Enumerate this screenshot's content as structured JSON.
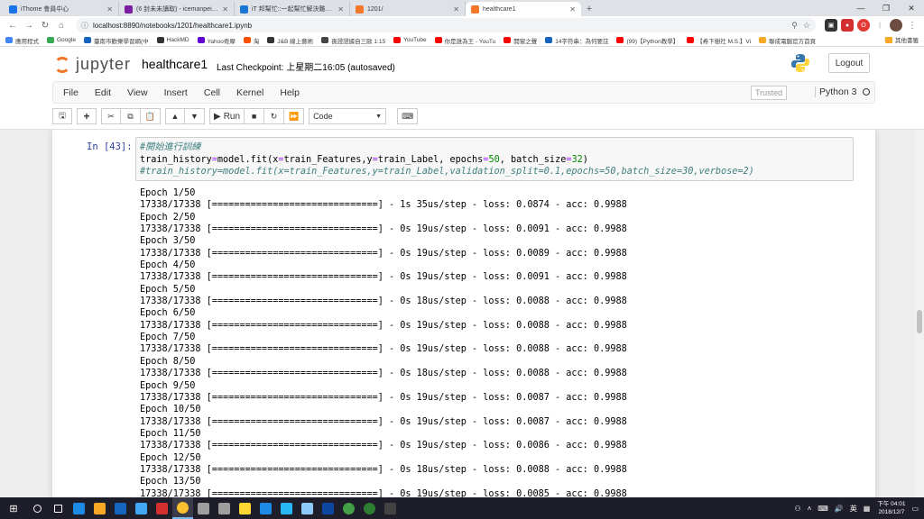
{
  "browser": {
    "tabs": [
      {
        "title": "iThome 會員中心",
        "color": "#1a73e8",
        "active": false
      },
      {
        "title": "(6 封未未讀取) - icemanpei@yahoo",
        "color": "#7b1fa2",
        "active": false
      },
      {
        "title": "iT 邦幫忙::一起幫忙解決難題，拯",
        "color": "#1976d2",
        "active": false
      },
      {
        "title": "1201/",
        "color": "#f37726",
        "active": false
      },
      {
        "title": "healthcare1",
        "color": "#f37726",
        "active": true
      }
    ],
    "url": "localhost:8890/notebooks/1201/healthcare1.ipynb",
    "bookmarks": [
      {
        "label": "應用程式",
        "color": "#4285f4"
      },
      {
        "label": "Google",
        "color": "#34a853"
      },
      {
        "label": "臺南市歡樂學習網(中",
        "color": "#1565c0"
      },
      {
        "label": "HackMD",
        "color": "#333333"
      },
      {
        "label": "Yahoo奇摩",
        "color": "#6001d2"
      },
      {
        "label": "淘",
        "color": "#ff5000"
      },
      {
        "label": "J&B 線上藝術",
        "color": "#333333"
      },
      {
        "label": "喪證證據自三歐 1:15",
        "color": "#444444"
      },
      {
        "label": "YouTube",
        "color": "#ff0000"
      },
      {
        "label": "你是誰為王 - YouTu",
        "color": "#ff0000"
      },
      {
        "label": "開窗之聲",
        "color": "#ff0000"
      },
      {
        "label": "14字符串：為何要註",
        "color": "#1565c0"
      },
      {
        "label": "(99)【Python教學】",
        "color": "#ff0000"
      },
      {
        "label": "【希下樹社 M.S.】Vi",
        "color": "#ff0000"
      },
      {
        "label": "聯成電腦官方首頁",
        "color": "#f9a825"
      }
    ],
    "bookmarks_more": "»",
    "bookmarks_other": "其他書籤"
  },
  "jupyter": {
    "logo_text": "jupyter",
    "notebook_name": "healthcare1",
    "checkpoint": "Last Checkpoint: 上星期二16:05   (autosaved)",
    "logout_label": "Logout",
    "menu": [
      "File",
      "Edit",
      "View",
      "Insert",
      "Cell",
      "Kernel",
      "Help"
    ],
    "trusted_label": "Trusted",
    "kernel_name": "Python 3",
    "toolbar": {
      "run_label": "Run",
      "cell_type": "Code"
    }
  },
  "cell": {
    "prompt": "In [43]:",
    "code_lines": [
      "#開始進行訓練",
      "train_history=model.fit(x=train_Features,y=train_Label, epochs=50, batch_size=32)",
      "#train_history=model.fit(x=train_Features,y=train_Label,validation_split=0.1,epochs=50,batch_size=30,verbose=2)"
    ],
    "output_lines": [
      "Epoch 1/50",
      "17338/17338 [==============================] - 1s 35us/step - loss: 0.0874 - acc: 0.9988",
      "Epoch 2/50",
      "17338/17338 [==============================] - 0s 19us/step - loss: 0.0091 - acc: 0.9988",
      "Epoch 3/50",
      "17338/17338 [==============================] - 0s 19us/step - loss: 0.0089 - acc: 0.9988",
      "Epoch 4/50",
      "17338/17338 [==============================] - 0s 19us/step - loss: 0.0091 - acc: 0.9988",
      "Epoch 5/50",
      "17338/17338 [==============================] - 0s 18us/step - loss: 0.0088 - acc: 0.9988",
      "Epoch 6/50",
      "17338/17338 [==============================] - 0s 19us/step - loss: 0.0088 - acc: 0.9988",
      "Epoch 7/50",
      "17338/17338 [==============================] - 0s 19us/step - loss: 0.0088 - acc: 0.9988",
      "Epoch 8/50",
      "17338/17338 [==============================] - 0s 18us/step - loss: 0.0088 - acc: 0.9988",
      "Epoch 9/50",
      "17338/17338 [==============================] - 0s 19us/step - loss: 0.0087 - acc: 0.9988",
      "Epoch 10/50",
      "17338/17338 [==============================] - 0s 19us/step - loss: 0.0087 - acc: 0.9988",
      "Epoch 11/50",
      "17338/17338 [==============================] - 0s 19us/step - loss: 0.0086 - acc: 0.9988",
      "Epoch 12/50",
      "17338/17338 [==============================] - 0s 18us/step - loss: 0.0088 - acc: 0.9988",
      "Epoch 13/50",
      "17338/17338 [==============================] - 0s 19us/step - loss: 0.0085 - acc: 0.9988"
    ]
  },
  "taskbar": {
    "apps": [
      {
        "name": "search",
        "color": "#ffffff"
      },
      {
        "name": "task-view",
        "color": "#ffffff"
      },
      {
        "name": "edge",
        "color": "#1e88e5"
      },
      {
        "name": "file-explorer",
        "color": "#f9a825"
      },
      {
        "name": "store",
        "color": "#1565c0"
      },
      {
        "name": "calendar",
        "color": "#42a5f5"
      },
      {
        "name": "app-red",
        "color": "#d32f2f"
      },
      {
        "name": "chrome",
        "color": "#fbc02d"
      },
      {
        "name": "app-gray",
        "color": "#9e9e9e"
      },
      {
        "name": "settings",
        "color": "#9e9e9e"
      },
      {
        "name": "app-yellow",
        "color": "#fdd835"
      },
      {
        "name": "vscode",
        "color": "#1e88e5"
      },
      {
        "name": "app-blue",
        "color": "#29b6f6"
      },
      {
        "name": "search-app",
        "color": "#90caf9"
      },
      {
        "name": "photoshop",
        "color": "#0d47a1"
      },
      {
        "name": "app-green1",
        "color": "#43a047"
      },
      {
        "name": "app-green2",
        "color": "#2e7d32"
      },
      {
        "name": "terminal",
        "color": "#424242"
      }
    ],
    "ime": "英",
    "time": "下午 04:01",
    "date": "2018/12/7"
  }
}
